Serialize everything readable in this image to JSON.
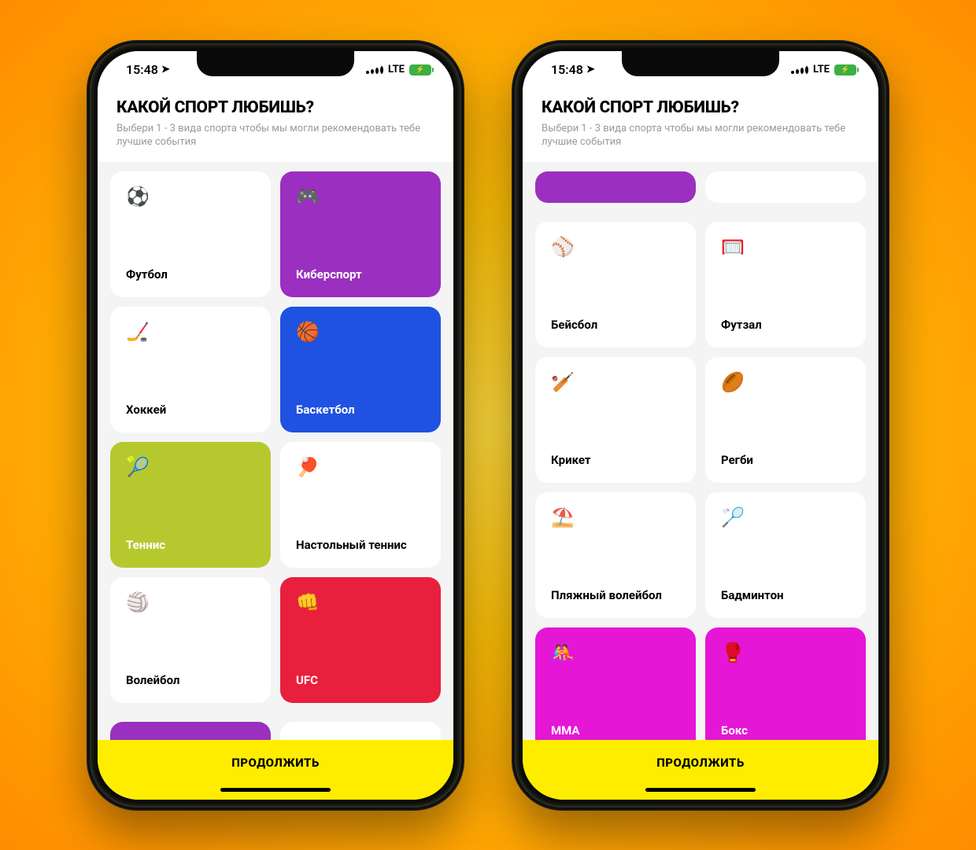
{
  "status": {
    "time": "15:48",
    "network": "LTE"
  },
  "header": {
    "title": "КАКОЙ СПОРТ ЛЮБИШЬ?",
    "subtitle": "Выбери 1 - 3 вида спорта чтобы мы могли рекомендовать тебе лучшие события"
  },
  "footer": {
    "continue": "ПРОДОЛЖИТЬ"
  },
  "colors": {
    "purple": "#9b2fbf",
    "blue": "#1f52e0",
    "olive": "#b5c92f",
    "red": "#e91f3e",
    "magenta": "#e516d6"
  },
  "phone1": {
    "cards": [
      {
        "icon": "⚽",
        "label": "Футбол",
        "selected": false
      },
      {
        "icon": "🎮",
        "label": "Киберспорт",
        "selected": true,
        "color": "purple"
      },
      {
        "icon": "🏒",
        "label": "Хоккей",
        "selected": false
      },
      {
        "icon": "🏀",
        "label": "Баскетбол",
        "selected": true,
        "color": "blue"
      },
      {
        "icon": "🎾",
        "label": "Теннис",
        "selected": true,
        "color": "olive"
      },
      {
        "icon": "🏓",
        "label": "Настольный теннис",
        "selected": false
      },
      {
        "icon": "🏐",
        "label": "Волейбол",
        "selected": false
      },
      {
        "icon": "👊",
        "label": "UFC",
        "selected": true,
        "color": "red"
      }
    ],
    "peek_bottom": [
      {
        "selected": true,
        "color": "purple"
      },
      {
        "selected": false
      }
    ]
  },
  "phone2": {
    "peek_top": [
      {
        "selected": true,
        "color": "purple"
      },
      {
        "selected": false
      }
    ],
    "cards": [
      {
        "icon": "⚾",
        "label": "Бейсбол",
        "selected": false
      },
      {
        "icon": "🥅",
        "label": "Футзал",
        "selected": false
      },
      {
        "icon": "🏏",
        "label": "Крикет",
        "selected": false
      },
      {
        "icon": "🏉",
        "label": "Регби",
        "selected": false
      },
      {
        "icon": "⛱️",
        "label": "Пляжный волейбол",
        "selected": false
      },
      {
        "icon": "🏸",
        "label": "Бадминтон",
        "selected": false
      },
      {
        "icon": "🤼",
        "label": "MMA",
        "selected": true,
        "color": "magenta"
      },
      {
        "icon": "🥊",
        "label": "Бокс",
        "selected": true,
        "color": "magenta"
      }
    ]
  }
}
